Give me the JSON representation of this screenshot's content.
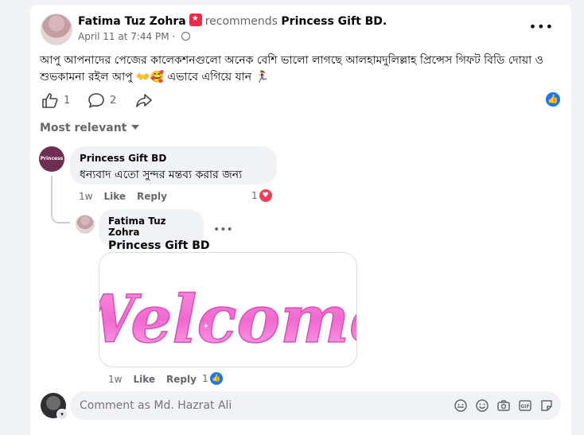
{
  "post": {
    "author": "Fatima Tuz Zohra",
    "recommends_text": "recommends",
    "page_name": "Princess Gift BD.",
    "date": "April 11 at 7:44 PM",
    "dot": "·",
    "more": "•••",
    "text": "আপু আপনাদের পেজের কালেকশনগুলো অনেক বেশি ভালো লাগছে আলহামদুলিল্লাহ প্রিন্সেস গিফট বিডি দোয়া ও শুভকামনা রইল আপু 👐🥰 এভাবে এগিয়ে যান 🏃‍♀️",
    "likes": "1",
    "comments_count": "2"
  },
  "filter": {
    "label": "Most relevant"
  },
  "comments": [
    {
      "author": "Princess Gift BD",
      "avatar_text": "Princess Gift",
      "text": "ধন্যবাদ এতো সুন্দর মন্তব্য করার জন্য",
      "time": "1w",
      "like_label": "Like",
      "reply_label": "Reply",
      "reaction_count": "1",
      "reaction_icon": "heart-icon"
    },
    {
      "author": "Fatima Tuz Zohra",
      "text": "Princess Gift BD",
      "more": "•••",
      "gif_text": "Welcome",
      "time": "1w",
      "like_label": "Like",
      "reply_label": "Reply",
      "reaction_count": "1",
      "reaction_icon": "like-icon"
    }
  ],
  "composer": {
    "placeholder": "Comment as Md. Hazrat Ali",
    "icons": [
      "avatar-sticker-icon",
      "emoji-icon",
      "camera-icon",
      "gif-icon",
      "sticker-icon"
    ]
  },
  "colors": {
    "accent": "#1877f2",
    "heart": "#f33e58",
    "gif_pink": "#f06ad0"
  }
}
